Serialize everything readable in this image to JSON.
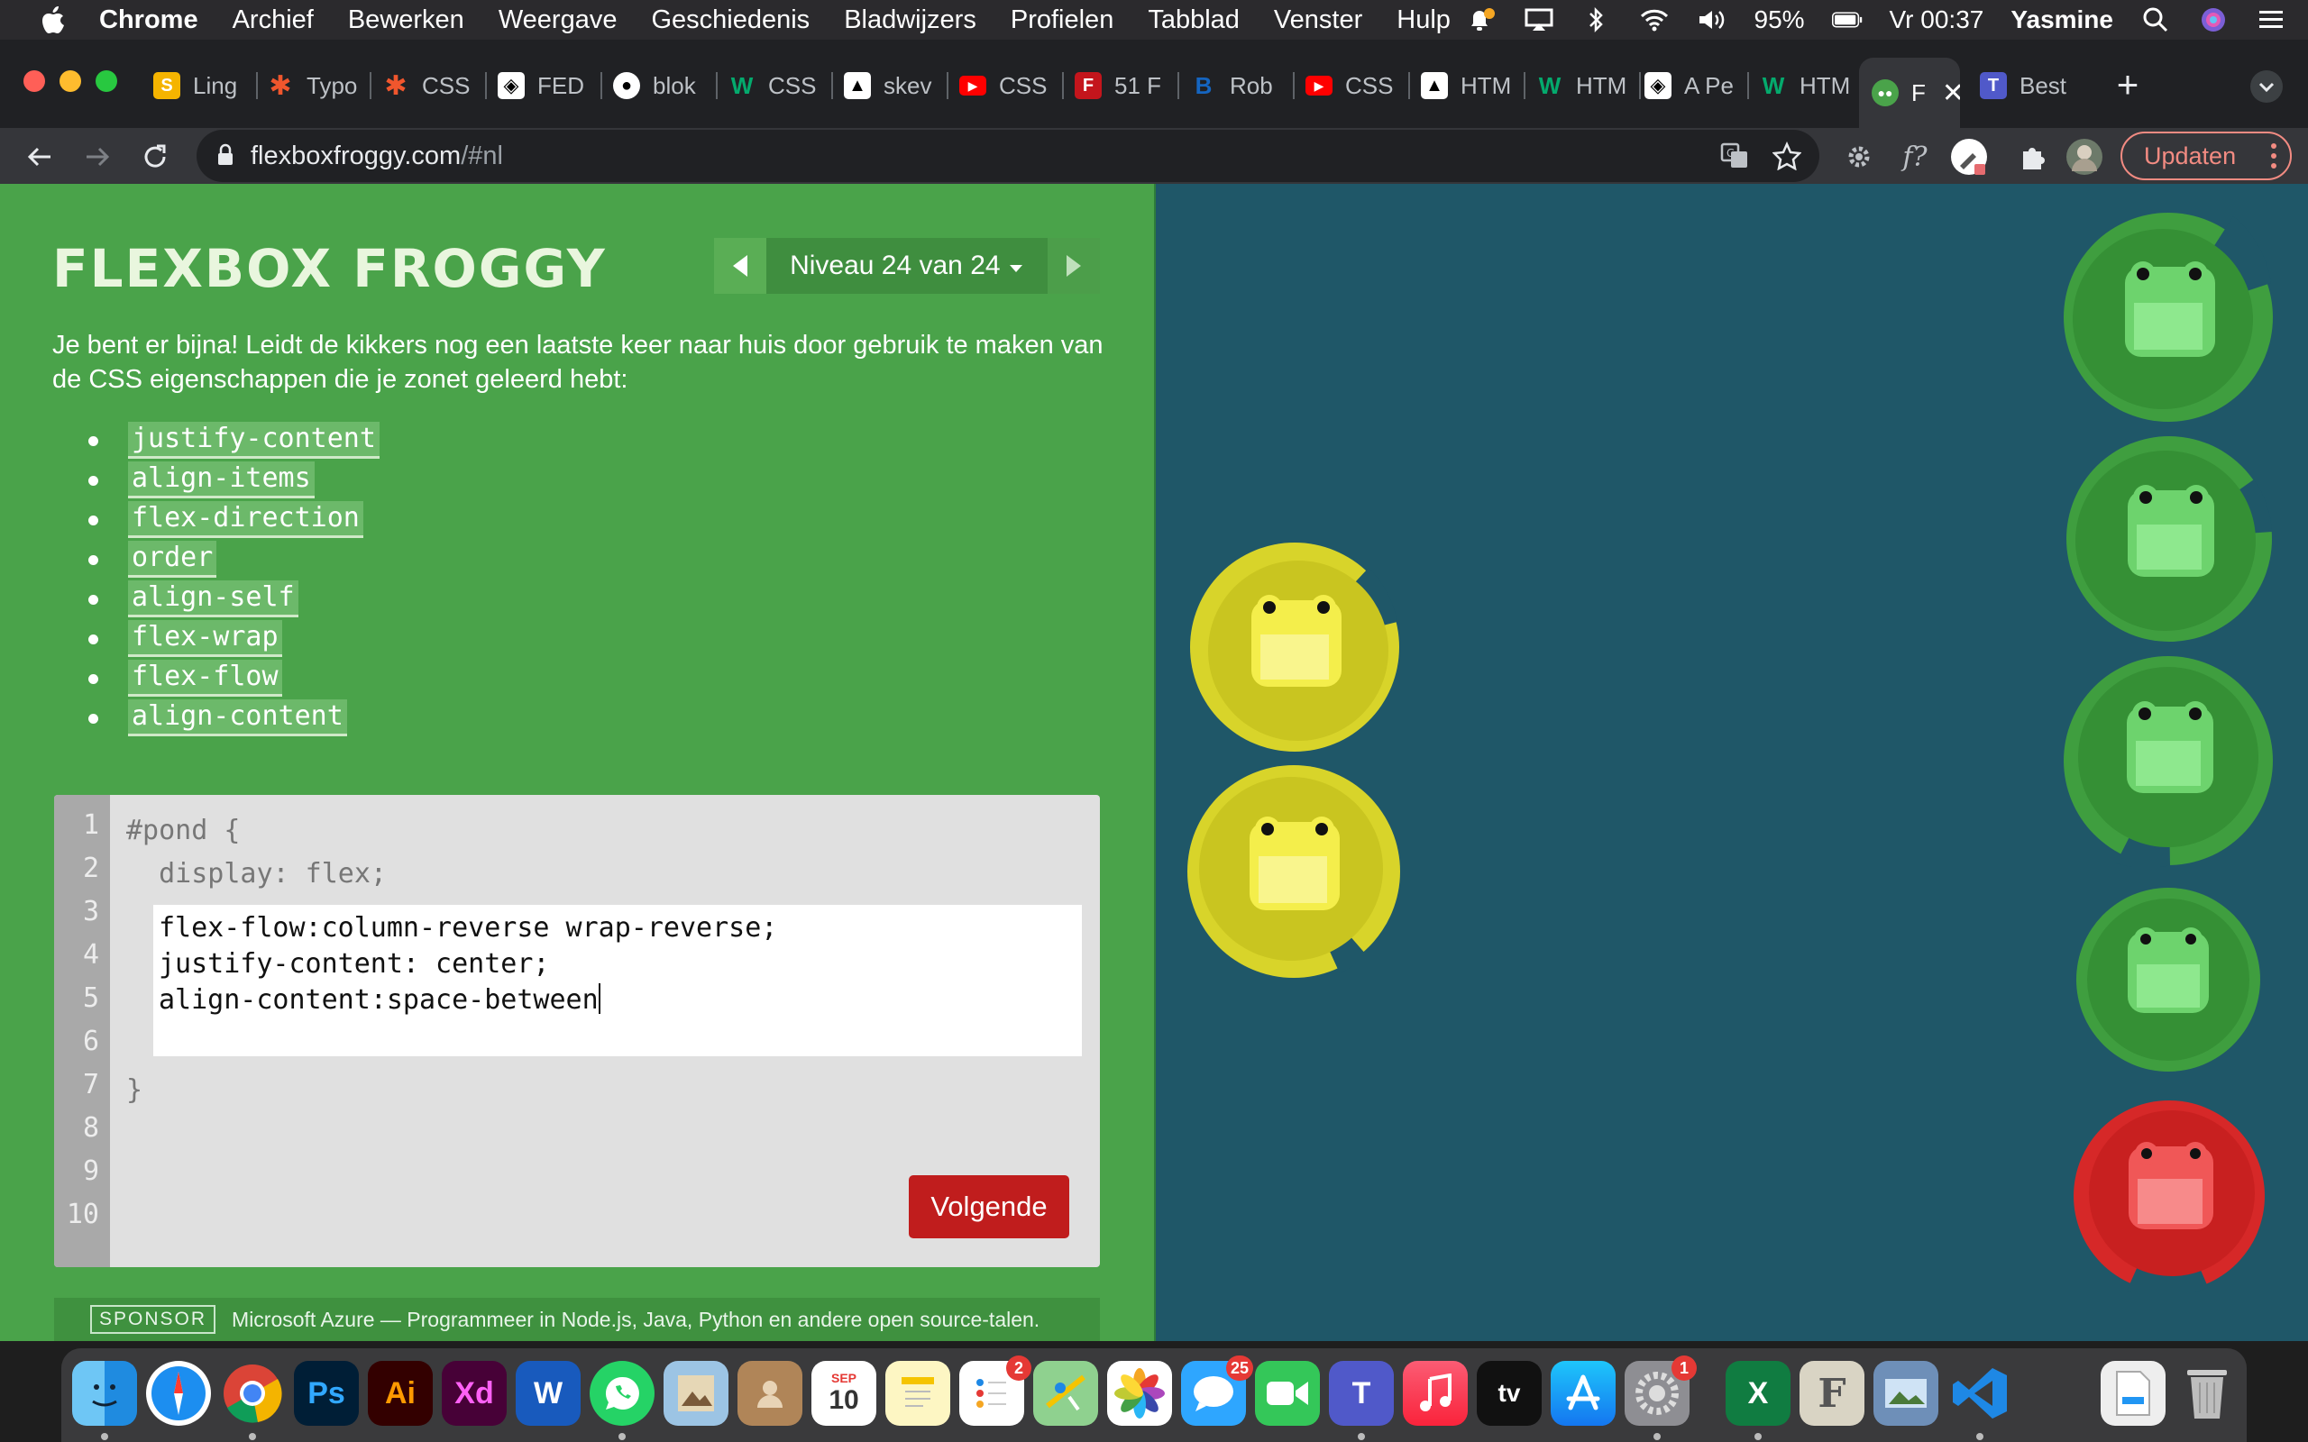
{
  "menubar": {
    "app": "Chrome",
    "menus": [
      "Archief",
      "Bewerken",
      "Weergave",
      "Geschiedenis",
      "Bladwijzers",
      "Profielen",
      "Tabblad",
      "Venster",
      "Hulp"
    ],
    "battery": "95%",
    "clock": "Vr 00:37",
    "user": "Yasmine"
  },
  "tabs": [
    {
      "label": "Ling",
      "icon": "notes-icon",
      "color": "#f5b400"
    },
    {
      "label": "Typo",
      "icon": "asterisk-icon",
      "color": "#f0562d"
    },
    {
      "label": "CSS",
      "icon": "asterisk-icon",
      "color": "#f0562d"
    },
    {
      "label": "FED",
      "icon": "codepen-icon",
      "color": "#000000"
    },
    {
      "label": "blok",
      "icon": "github-icon",
      "color": "#000000"
    },
    {
      "label": "CSS",
      "icon": "w3-icon",
      "color": "#04aa6d"
    },
    {
      "label": "skev",
      "icon": "bird-icon",
      "color": "#000000"
    },
    {
      "label": "CSS",
      "icon": "youtube-icon",
      "color": "#ff0000"
    },
    {
      "label": "51 F",
      "icon": "f-icon",
      "color": "#c4151c"
    },
    {
      "label": "Rob",
      "icon": "letter-b-icon",
      "color": "#1565c0"
    },
    {
      "label": "CSS",
      "icon": "youtube-icon",
      "color": "#ff0000"
    },
    {
      "label": "HTM",
      "icon": "bird-icon",
      "color": "#000000"
    },
    {
      "label": "HTM",
      "icon": "w3-icon",
      "color": "#04aa6d"
    },
    {
      "label": "A Pe",
      "icon": "codepen-icon",
      "color": "#000000"
    },
    {
      "label": "HTM",
      "icon": "w3-icon",
      "color": "#04aa6d"
    },
    {
      "label": "F",
      "icon": "frog-icon",
      "color": "#4aa34a",
      "active": true
    },
    {
      "label": "Best",
      "icon": "teams-icon",
      "color": "#5059c9"
    }
  ],
  "toolbar": {
    "url_host": "flexboxfroggy.com",
    "url_path": "/#nl",
    "update_label": "Updaten"
  },
  "game": {
    "title": "FLEXBOX FROGGY",
    "level_label": "Niveau 24 van 24",
    "intro": "Je bent er bijna! Leidt de kikkers nog een laatste keer naar huis door gebruik te maken van de CSS eigenschappen die je zonet geleerd hebt:",
    "properties": [
      "justify-content",
      "align-items",
      "flex-direction",
      "order",
      "align-self",
      "flex-wrap",
      "flex-flow",
      "align-content"
    ],
    "line_numbers": [
      "1",
      "2",
      "3",
      "4",
      "5",
      "6",
      "7",
      "8",
      "9",
      "10"
    ],
    "code_open": "#pond {",
    "code_display": "  display: flex;",
    "code_close": "}",
    "answer_lines": [
      "flex-flow:column-reverse wrap-reverse;",
      "justify-content: center;",
      "align-content:space-between"
    ],
    "next_label": "Volgende",
    "sponsor_tag": "SPONSOR",
    "sponsor_text": "Microsoft Azure — Programmeer in Node.js, Java, Python en andere open source-talen."
  },
  "pond": {
    "pads": [
      {
        "color": "green",
        "hex": "#3f9e3f"
      },
      {
        "color": "green",
        "hex": "#3f9e3f"
      },
      {
        "color": "green",
        "hex": "#3f9e3f"
      },
      {
        "color": "green",
        "hex": "#3f9e3f"
      },
      {
        "color": "red",
        "hex": "#d62828"
      },
      {
        "color": "yellow",
        "hex": "#d8d42a"
      },
      {
        "color": "yellow",
        "hex": "#d8d42a"
      }
    ]
  },
  "dock": {
    "apps": [
      {
        "name": "Finder",
        "icon": "finder-icon"
      },
      {
        "name": "Safari",
        "icon": "safari-icon"
      },
      {
        "name": "Chrome",
        "icon": "chrome-icon"
      },
      {
        "name": "Photoshop",
        "icon": "photoshop-icon",
        "text": "Ps"
      },
      {
        "name": "Illustrator",
        "icon": "illustrator-icon",
        "text": "Ai"
      },
      {
        "name": "Adobe XD",
        "icon": "xd-icon",
        "text": "Xd"
      },
      {
        "name": "Word",
        "icon": "word-icon",
        "text": "W"
      },
      {
        "name": "WhatsApp",
        "icon": "whatsapp-icon"
      },
      {
        "name": "Preview",
        "icon": "preview-icon"
      },
      {
        "name": "Contacts",
        "icon": "contacts-icon"
      },
      {
        "name": "Calendar",
        "icon": "calendar-icon",
        "text": "10",
        "month": "SEP"
      },
      {
        "name": "Notes",
        "icon": "notes-icon"
      },
      {
        "name": "Reminders",
        "icon": "reminders-icon",
        "badge": "2"
      },
      {
        "name": "Maps",
        "icon": "maps-icon"
      },
      {
        "name": "Photos",
        "icon": "photos-icon"
      },
      {
        "name": "Messages",
        "icon": "messages-icon",
        "badge": "25"
      },
      {
        "name": "FaceTime",
        "icon": "facetime-icon"
      },
      {
        "name": "Teams",
        "icon": "teams-icon",
        "text": "T"
      },
      {
        "name": "Music",
        "icon": "music-icon"
      },
      {
        "name": "TV",
        "icon": "tv-icon",
        "text": "tv"
      },
      {
        "name": "App Store",
        "icon": "appstore-icon"
      },
      {
        "name": "System Preferences",
        "icon": "settings-icon",
        "badge": "1"
      },
      {
        "name": "Excel",
        "icon": "excel-icon",
        "text": "X"
      },
      {
        "name": "Font Book",
        "icon": "fontbook-icon",
        "text": "F"
      },
      {
        "name": "Image Capture",
        "icon": "imagecapture-icon"
      },
      {
        "name": "VS Code",
        "icon": "vscode-icon"
      },
      {
        "name": "Downloads",
        "icon": "file-icon"
      },
      {
        "name": "Trash",
        "icon": "trash-icon"
      }
    ]
  }
}
